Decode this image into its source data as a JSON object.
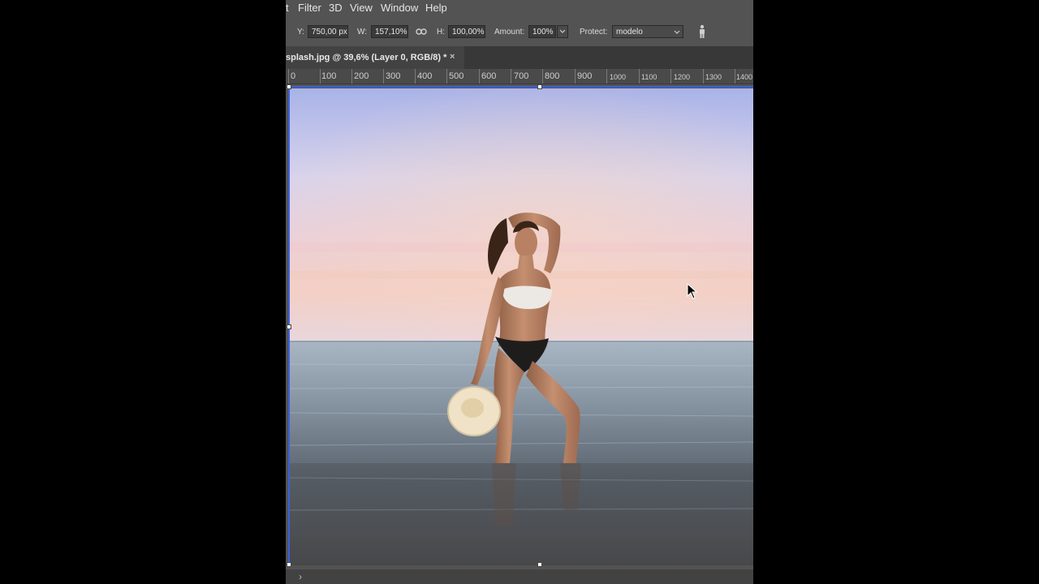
{
  "menubar": {
    "items": [
      "t",
      "Filter",
      "3D",
      "View",
      "Window",
      "Help"
    ]
  },
  "options": {
    "y_label": "Y:",
    "y_value": "750,00 px",
    "w_label": "W:",
    "w_value": "157,10%",
    "h_label": "H:",
    "h_value": "100,00%",
    "amount_label": "Amount:",
    "amount_value": "100%",
    "protect_label": "Protect:",
    "protect_value": "modelo"
  },
  "tab": {
    "title": "splash.jpg @ 39,6% (Layer 0, RGB/8) *",
    "close": "×"
  },
  "ruler": {
    "labels": [
      "0",
      "100",
      "200",
      "300",
      "400",
      "500",
      "600",
      "700",
      "800",
      "900",
      "1000",
      "1100",
      "1200",
      "1300",
      "1400"
    ]
  },
  "status": {
    "arrow": "›"
  },
  "icons": {
    "link": "link-icon",
    "protect_skin": "person-icon",
    "cursor": "mouse-pointer-icon"
  },
  "colors": {
    "transform_box": "#3b5fd9",
    "ui_bg": "#535353"
  }
}
